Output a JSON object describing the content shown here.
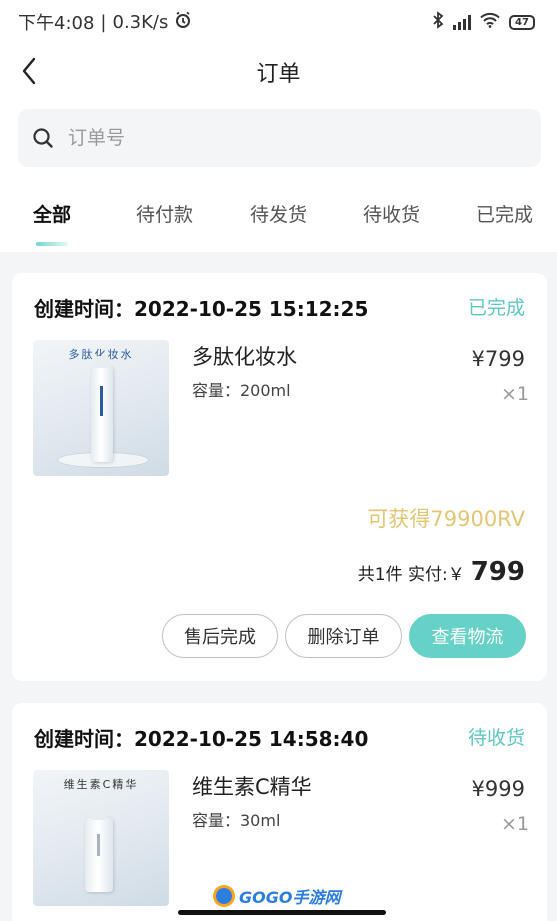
{
  "status_bar": {
    "time": "下午4:08",
    "separator": "|",
    "net_speed": "0.3K/s",
    "battery": "47",
    "icons": [
      "alarm-icon",
      "bluetooth-icon",
      "signal-icon",
      "wifi-icon",
      "battery-icon"
    ]
  },
  "header": {
    "title": "订单"
  },
  "search": {
    "placeholder": "订单号"
  },
  "tabs": [
    {
      "label": "全部",
      "active": true
    },
    {
      "label": "待付款",
      "active": false
    },
    {
      "label": "待发货",
      "active": false
    },
    {
      "label": "待收货",
      "active": false
    },
    {
      "label": "已完成",
      "active": false
    }
  ],
  "orders": [
    {
      "created_time": "创建时间：2022-10-25 15:12:25",
      "status": "已完成",
      "product": {
        "image_caption": "多肽化妆水",
        "name": "多肽化妆水",
        "spec": "容量：200ml",
        "price": "¥799",
        "qty": "×1"
      },
      "reward": "可获得79900RV",
      "total_label": "共1件 实付:￥",
      "total_amount": "799",
      "buttons": [
        "售后完成",
        "删除订单",
        "查看物流"
      ]
    },
    {
      "created_time": "创建时间：2022-10-25 14:58:40",
      "status": "待收货",
      "product": {
        "image_caption": "维生素C精华",
        "name": "维生素C精华",
        "spec": "容量：30ml",
        "price": "¥999",
        "qty": "×1"
      }
    }
  ],
  "watermark": {
    "text": "GOGO手游网"
  },
  "colors": {
    "accent": "#66d1c6",
    "status_text": "#5ec8c0",
    "reward_text": "#e3c573",
    "background": "#f4f5f7"
  }
}
